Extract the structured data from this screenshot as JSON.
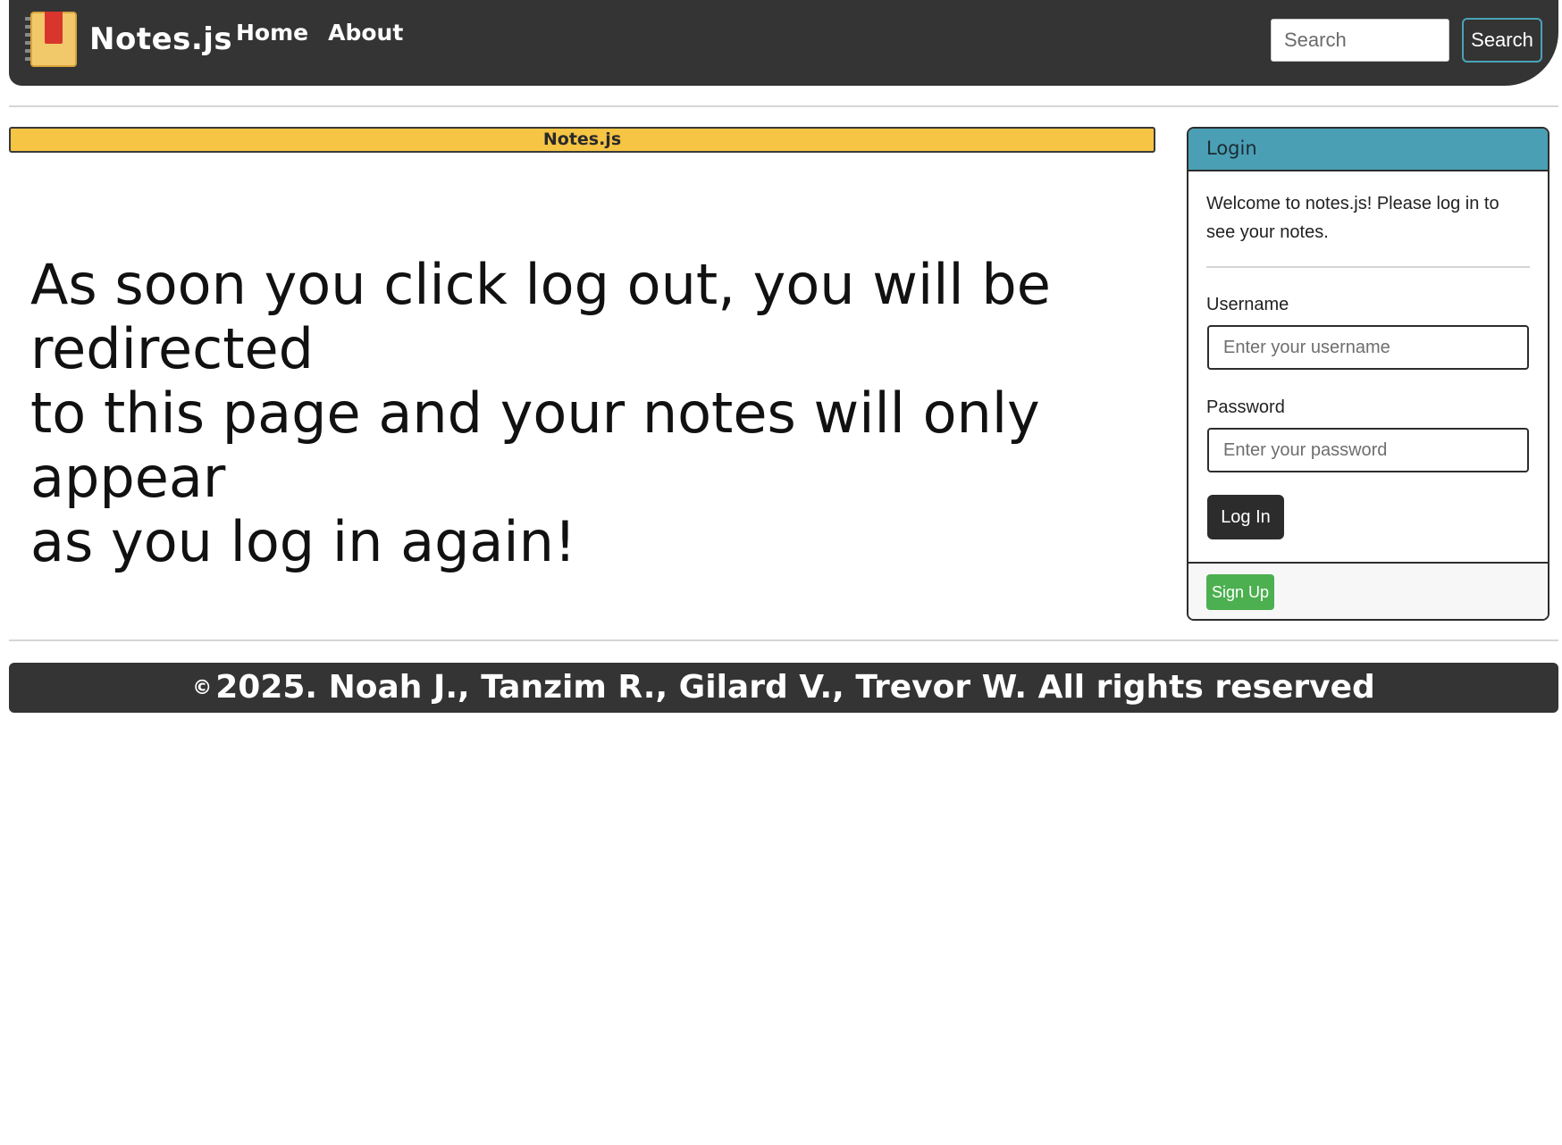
{
  "navbar": {
    "brand": "Notes.js",
    "logo_icon": "notebook-icon",
    "links": [
      {
        "label": "Home"
      },
      {
        "label": "About"
      }
    ],
    "search": {
      "placeholder": "Search",
      "button_label": "Search"
    },
    "colors": {
      "background": "#343434",
      "search_border": "#4aa3b8"
    }
  },
  "banner": {
    "title": "Notes.js",
    "color": "#f6c544"
  },
  "main": {
    "message_lines": [
      "As soon you click log out, you will be redirected",
      "to this page and your notes will only appear",
      "as you log in again!"
    ]
  },
  "login": {
    "header": "Login",
    "header_color": "#4a9fb5",
    "welcome": "Welcome to notes.js! Please log in to see your notes.",
    "username_label": "Username",
    "username_placeholder": "Enter your username",
    "password_label": "Password",
    "password_placeholder": "Enter your password",
    "login_button": "Log In",
    "signup_button": "Sign Up",
    "signup_color": "#4caf50"
  },
  "footer": {
    "copyright_symbol": "©",
    "text": "2025. Noah J., Tanzim R., Gilard V., Trevor W. All rights reserved"
  }
}
